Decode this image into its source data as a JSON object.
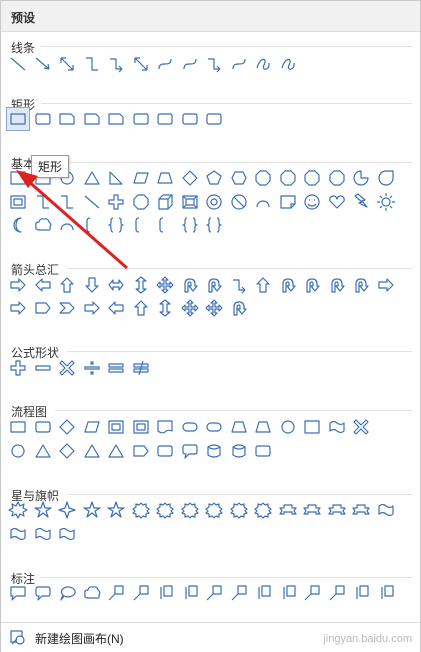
{
  "header": {
    "title": "预设"
  },
  "sections": {
    "lines": "线条",
    "rect": "矩形",
    "basic": "基本形状",
    "arrows": "箭头总汇",
    "formula": "公式形状",
    "flowchart": "流程图",
    "stars": "星与旗帜",
    "callouts": "标注"
  },
  "tooltip": {
    "text": "矩形"
  },
  "footer": {
    "new_canvas_label": "新建绘图画布(N)"
  },
  "watermark": "jingyan.baidu.com",
  "colors": {
    "icon": "#3b6fb6",
    "arrow": "#e02020",
    "selected_bg": "#dfe8f5"
  }
}
